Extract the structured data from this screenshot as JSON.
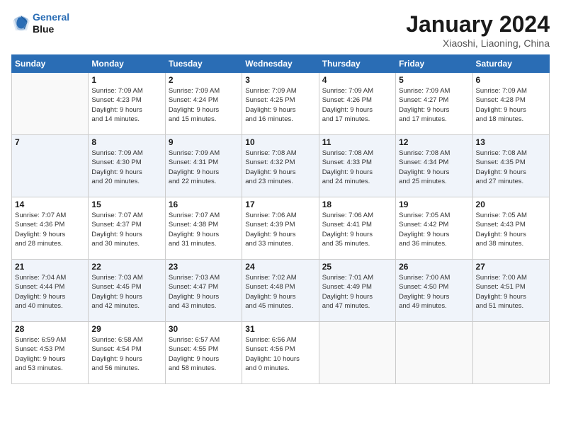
{
  "logo": {
    "line1": "General",
    "line2": "Blue"
  },
  "title": "January 2024",
  "subtitle": "Xiaoshi, Liaoning, China",
  "weekdays": [
    "Sunday",
    "Monday",
    "Tuesday",
    "Wednesday",
    "Thursday",
    "Friday",
    "Saturday"
  ],
  "weeks": [
    [
      {
        "day": "",
        "info": ""
      },
      {
        "day": "1",
        "info": "Sunrise: 7:09 AM\nSunset: 4:23 PM\nDaylight: 9 hours\nand 14 minutes."
      },
      {
        "day": "2",
        "info": "Sunrise: 7:09 AM\nSunset: 4:24 PM\nDaylight: 9 hours\nand 15 minutes."
      },
      {
        "day": "3",
        "info": "Sunrise: 7:09 AM\nSunset: 4:25 PM\nDaylight: 9 hours\nand 16 minutes."
      },
      {
        "day": "4",
        "info": "Sunrise: 7:09 AM\nSunset: 4:26 PM\nDaylight: 9 hours\nand 17 minutes."
      },
      {
        "day": "5",
        "info": "Sunrise: 7:09 AM\nSunset: 4:27 PM\nDaylight: 9 hours\nand 17 minutes."
      },
      {
        "day": "6",
        "info": "Sunrise: 7:09 AM\nSunset: 4:28 PM\nDaylight: 9 hours\nand 18 minutes."
      }
    ],
    [
      {
        "day": "7",
        "info": ""
      },
      {
        "day": "8",
        "info": "Sunrise: 7:09 AM\nSunset: 4:30 PM\nDaylight: 9 hours\nand 20 minutes."
      },
      {
        "day": "9",
        "info": "Sunrise: 7:09 AM\nSunset: 4:31 PM\nDaylight: 9 hours\nand 22 minutes."
      },
      {
        "day": "10",
        "info": "Sunrise: 7:08 AM\nSunset: 4:32 PM\nDaylight: 9 hours\nand 23 minutes."
      },
      {
        "day": "11",
        "info": "Sunrise: 7:08 AM\nSunset: 4:33 PM\nDaylight: 9 hours\nand 24 minutes."
      },
      {
        "day": "12",
        "info": "Sunrise: 7:08 AM\nSunset: 4:34 PM\nDaylight: 9 hours\nand 25 minutes."
      },
      {
        "day": "13",
        "info": "Sunrise: 7:08 AM\nSunset: 4:35 PM\nDaylight: 9 hours\nand 27 minutes."
      }
    ],
    [
      {
        "day": "14",
        "info": "Sunrise: 7:07 AM\nSunset: 4:36 PM\nDaylight: 9 hours\nand 28 minutes."
      },
      {
        "day": "15",
        "info": "Sunrise: 7:07 AM\nSunset: 4:37 PM\nDaylight: 9 hours\nand 30 minutes."
      },
      {
        "day": "16",
        "info": "Sunrise: 7:07 AM\nSunset: 4:38 PM\nDaylight: 9 hours\nand 31 minutes."
      },
      {
        "day": "17",
        "info": "Sunrise: 7:06 AM\nSunset: 4:39 PM\nDaylight: 9 hours\nand 33 minutes."
      },
      {
        "day": "18",
        "info": "Sunrise: 7:06 AM\nSunset: 4:41 PM\nDaylight: 9 hours\nand 35 minutes."
      },
      {
        "day": "19",
        "info": "Sunrise: 7:05 AM\nSunset: 4:42 PM\nDaylight: 9 hours\nand 36 minutes."
      },
      {
        "day": "20",
        "info": "Sunrise: 7:05 AM\nSunset: 4:43 PM\nDaylight: 9 hours\nand 38 minutes."
      }
    ],
    [
      {
        "day": "21",
        "info": "Sunrise: 7:04 AM\nSunset: 4:44 PM\nDaylight: 9 hours\nand 40 minutes."
      },
      {
        "day": "22",
        "info": "Sunrise: 7:03 AM\nSunset: 4:45 PM\nDaylight: 9 hours\nand 42 minutes."
      },
      {
        "day": "23",
        "info": "Sunrise: 7:03 AM\nSunset: 4:47 PM\nDaylight: 9 hours\nand 43 minutes."
      },
      {
        "day": "24",
        "info": "Sunrise: 7:02 AM\nSunset: 4:48 PM\nDaylight: 9 hours\nand 45 minutes."
      },
      {
        "day": "25",
        "info": "Sunrise: 7:01 AM\nSunset: 4:49 PM\nDaylight: 9 hours\nand 47 minutes."
      },
      {
        "day": "26",
        "info": "Sunrise: 7:00 AM\nSunset: 4:50 PM\nDaylight: 9 hours\nand 49 minutes."
      },
      {
        "day": "27",
        "info": "Sunrise: 7:00 AM\nSunset: 4:51 PM\nDaylight: 9 hours\nand 51 minutes."
      }
    ],
    [
      {
        "day": "28",
        "info": "Sunrise: 6:59 AM\nSunset: 4:53 PM\nDaylight: 9 hours\nand 53 minutes."
      },
      {
        "day": "29",
        "info": "Sunrise: 6:58 AM\nSunset: 4:54 PM\nDaylight: 9 hours\nand 56 minutes."
      },
      {
        "day": "30",
        "info": "Sunrise: 6:57 AM\nSunset: 4:55 PM\nDaylight: 9 hours\nand 58 minutes."
      },
      {
        "day": "31",
        "info": "Sunrise: 6:56 AM\nSunset: 4:56 PM\nDaylight: 10 hours\nand 0 minutes."
      },
      {
        "day": "",
        "info": ""
      },
      {
        "day": "",
        "info": ""
      },
      {
        "day": "",
        "info": ""
      }
    ]
  ]
}
